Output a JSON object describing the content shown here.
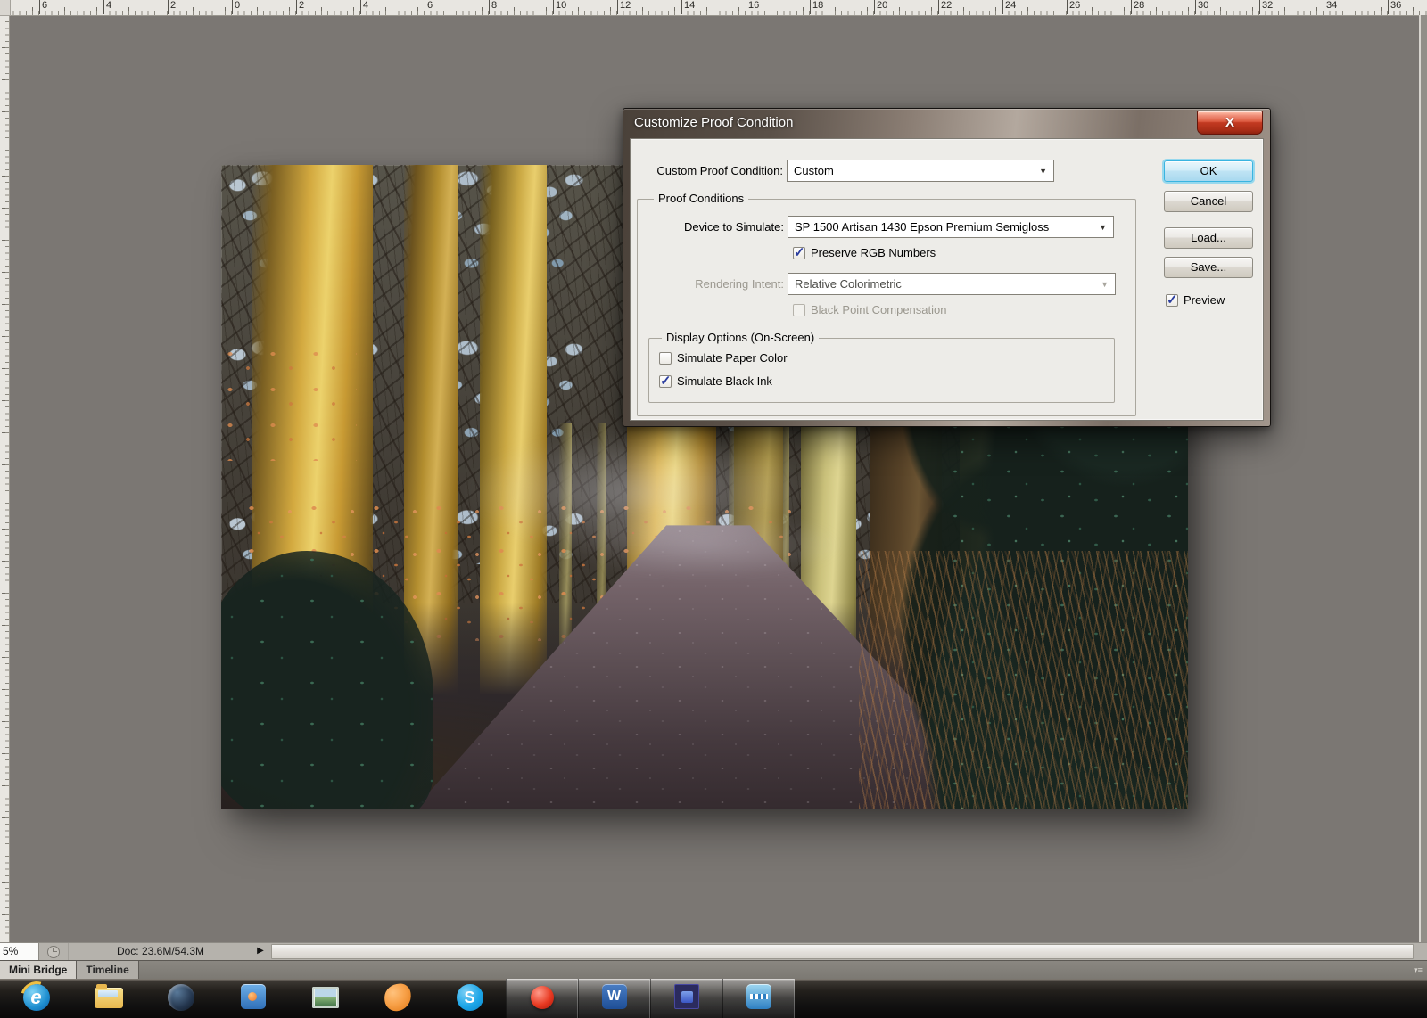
{
  "colors": {
    "canvas_gray": "#7b7773",
    "dialog_bg": "#edece8",
    "default_button_glow": "#3ab4e0",
    "close_button_red": "#c33a22",
    "check_blue": "#2b3d9e"
  },
  "ruler": {
    "unit_labels": [
      "6",
      "4",
      "2",
      "0",
      "2",
      "4",
      "6",
      "8",
      "10",
      "12",
      "14",
      "16",
      "18",
      "20",
      "22",
      "24",
      "26",
      "28",
      "30",
      "32",
      "34",
      "36"
    ]
  },
  "dialog": {
    "title": "Customize Proof Condition",
    "close_glyph": "X",
    "custom_proof_condition_label": "Custom Proof Condition:",
    "custom_proof_condition_value": "Custom",
    "proof_conditions_group_label": "Proof Conditions",
    "device_to_simulate_label": "Device to Simulate:",
    "device_to_simulate_value": "SP 1500 Artisan 1430 Epson Premium Semigloss",
    "preserve_rgb_label": "Preserve RGB Numbers",
    "preserve_rgb_checked": true,
    "rendering_intent_label": "Rendering Intent:",
    "rendering_intent_value": "Relative Colorimetric",
    "black_point_label": "Black Point Compensation",
    "black_point_checked": false,
    "display_options_group_label": "Display Options (On-Screen)",
    "simulate_paper_label": "Simulate Paper Color",
    "simulate_paper_checked": false,
    "simulate_ink_label": "Simulate Black Ink",
    "simulate_ink_checked": true,
    "ok_label": "OK",
    "cancel_label": "Cancel",
    "load_label": "Load...",
    "save_label": "Save...",
    "preview_label": "Preview",
    "preview_checked": true
  },
  "status_bar": {
    "zoom_value": "5%",
    "doc_info": "Doc: 23.6M/54.3M",
    "menu_arrow": "▶"
  },
  "panel_tabs": {
    "mini_bridge": "Mini Bridge",
    "timeline": "Timeline"
  },
  "taskbar": {
    "icons": [
      {
        "name": "internet-explorer-icon",
        "glyph": "e",
        "tile": false
      },
      {
        "name": "folder-explorer-icon",
        "glyph": "",
        "tile": false
      },
      {
        "name": "media-player-globe-icon",
        "glyph": "",
        "tile": false
      },
      {
        "name": "blue-window-app-icon",
        "glyph": "",
        "tile": false
      },
      {
        "name": "photo-viewer-icon",
        "glyph": "",
        "tile": false
      },
      {
        "name": "orange-pet-app-icon",
        "glyph": "",
        "tile": false
      },
      {
        "name": "skype-icon",
        "glyph": "S",
        "tile": false
      },
      {
        "name": "screen-recorder-icon",
        "glyph": "",
        "tile": true
      },
      {
        "name": "word-icon",
        "glyph": "W",
        "tile": true
      },
      {
        "name": "premiere-app-icon",
        "glyph": "",
        "tile": true
      },
      {
        "name": "movie-maker-icon",
        "glyph": "",
        "tile": true
      }
    ]
  }
}
